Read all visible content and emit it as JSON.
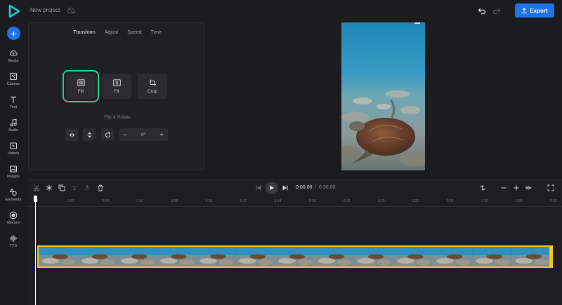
{
  "header": {
    "project_title": "New project",
    "export_label": "Export"
  },
  "sidebar": {
    "items": [
      {
        "label": "Media",
        "icon": "cloud-upload-icon"
      },
      {
        "label": "Canvas",
        "icon": "canvas-icon"
      },
      {
        "label": "Text",
        "icon": "text-icon"
      },
      {
        "label": "Audio",
        "icon": "music-note-icon"
      },
      {
        "label": "Videos",
        "icon": "video-icon"
      },
      {
        "label": "Images",
        "icon": "image-icon"
      },
      {
        "label": "Elements",
        "icon": "shapes-icon"
      },
      {
        "label": "Record",
        "icon": "record-icon"
      },
      {
        "label": "TTS",
        "icon": "waveform-icon"
      }
    ]
  },
  "panel": {
    "tabs": [
      "Transform",
      "Adjust",
      "Speed",
      "Time"
    ],
    "active_tab": "Transform",
    "modes": [
      "Fill",
      "Fit",
      "Crop"
    ],
    "selected_mode": "Fill",
    "flip_rotate_label": "Flip & Rotate",
    "rotation_value": "0°",
    "minus": "−",
    "plus": "+"
  },
  "timeline": {
    "current_time": "0:00.00",
    "separator": "/",
    "total_time": "0:30.00",
    "ticks": [
      "0",
      "0:02",
      "0:04",
      "0:06",
      "0:08",
      "0:10",
      "0:12",
      "0:14",
      "0:16",
      "0:18",
      "0:20",
      "0:22",
      "0:24",
      "0:26",
      "0:28",
      "0:30"
    ]
  },
  "colors": {
    "accent": "#1f74e8",
    "selection": "#1fd58c",
    "clip_border": "#f5c518"
  }
}
